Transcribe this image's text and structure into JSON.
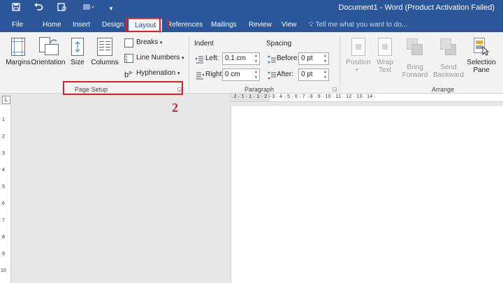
{
  "titlebar": {
    "title": "Document1 - Word (Product Activation Failed)",
    "icons": [
      "save-icon",
      "undo-icon",
      "print-preview-icon",
      "customize-icon"
    ]
  },
  "tabs": [
    {
      "label": "File"
    },
    {
      "label": "Home"
    },
    {
      "label": "Insert"
    },
    {
      "label": "Design"
    },
    {
      "label": "Layout",
      "active": true
    },
    {
      "label": "References"
    },
    {
      "label": "Mailings"
    },
    {
      "label": "Review"
    },
    {
      "label": "View"
    }
  ],
  "tellme_placeholder": "Tell me what you want to do...",
  "page_setup": {
    "margins": "Margins",
    "orientation": "Orientation",
    "size": "Size",
    "columns": "Columns",
    "breaks": "Breaks",
    "line_numbers": "Line Numbers",
    "hyphenation": "Hyphenation",
    "group_label": "Page Setup"
  },
  "paragraph": {
    "indent_label": "Indent",
    "spacing_label": "Spacing",
    "left_label": "Left:",
    "right_label": "Right:",
    "left_value": "0.1 cm",
    "right_value": "0 cm",
    "before_label": "Before:",
    "after_label": "After:",
    "before_value": "0 pt",
    "after_value": "0 pt",
    "group_label": "Paragraph"
  },
  "arrange": {
    "position": "Position",
    "wrap_text_1": "Wrap",
    "wrap_text_2": "Text",
    "bring_forward_1": "Bring",
    "bring_forward_2": "Forward",
    "send_backward_1": "Send",
    "send_backward_2": "Backward",
    "selection_pane_1": "Selection",
    "selection_pane_2": "Pane",
    "group_label": "Arrange"
  },
  "annotations": {
    "step1": "1",
    "step2": "2"
  },
  "ruler": {
    "h_ticks": "· 2 · 1 · 1 · 1 · 2 · 3 · 4 · 5 · 6 · 7 · 8 · 9 · 10 · 11 · 12 · 13 · 14 ·",
    "v_ticks": [
      "1",
      "2",
      "3",
      "4",
      "5",
      "6",
      "7",
      "8",
      "9",
      "10"
    ],
    "corner": "L"
  },
  "colors": {
    "word_blue": "#2b579a",
    "annotation_red": "#e02020"
  }
}
